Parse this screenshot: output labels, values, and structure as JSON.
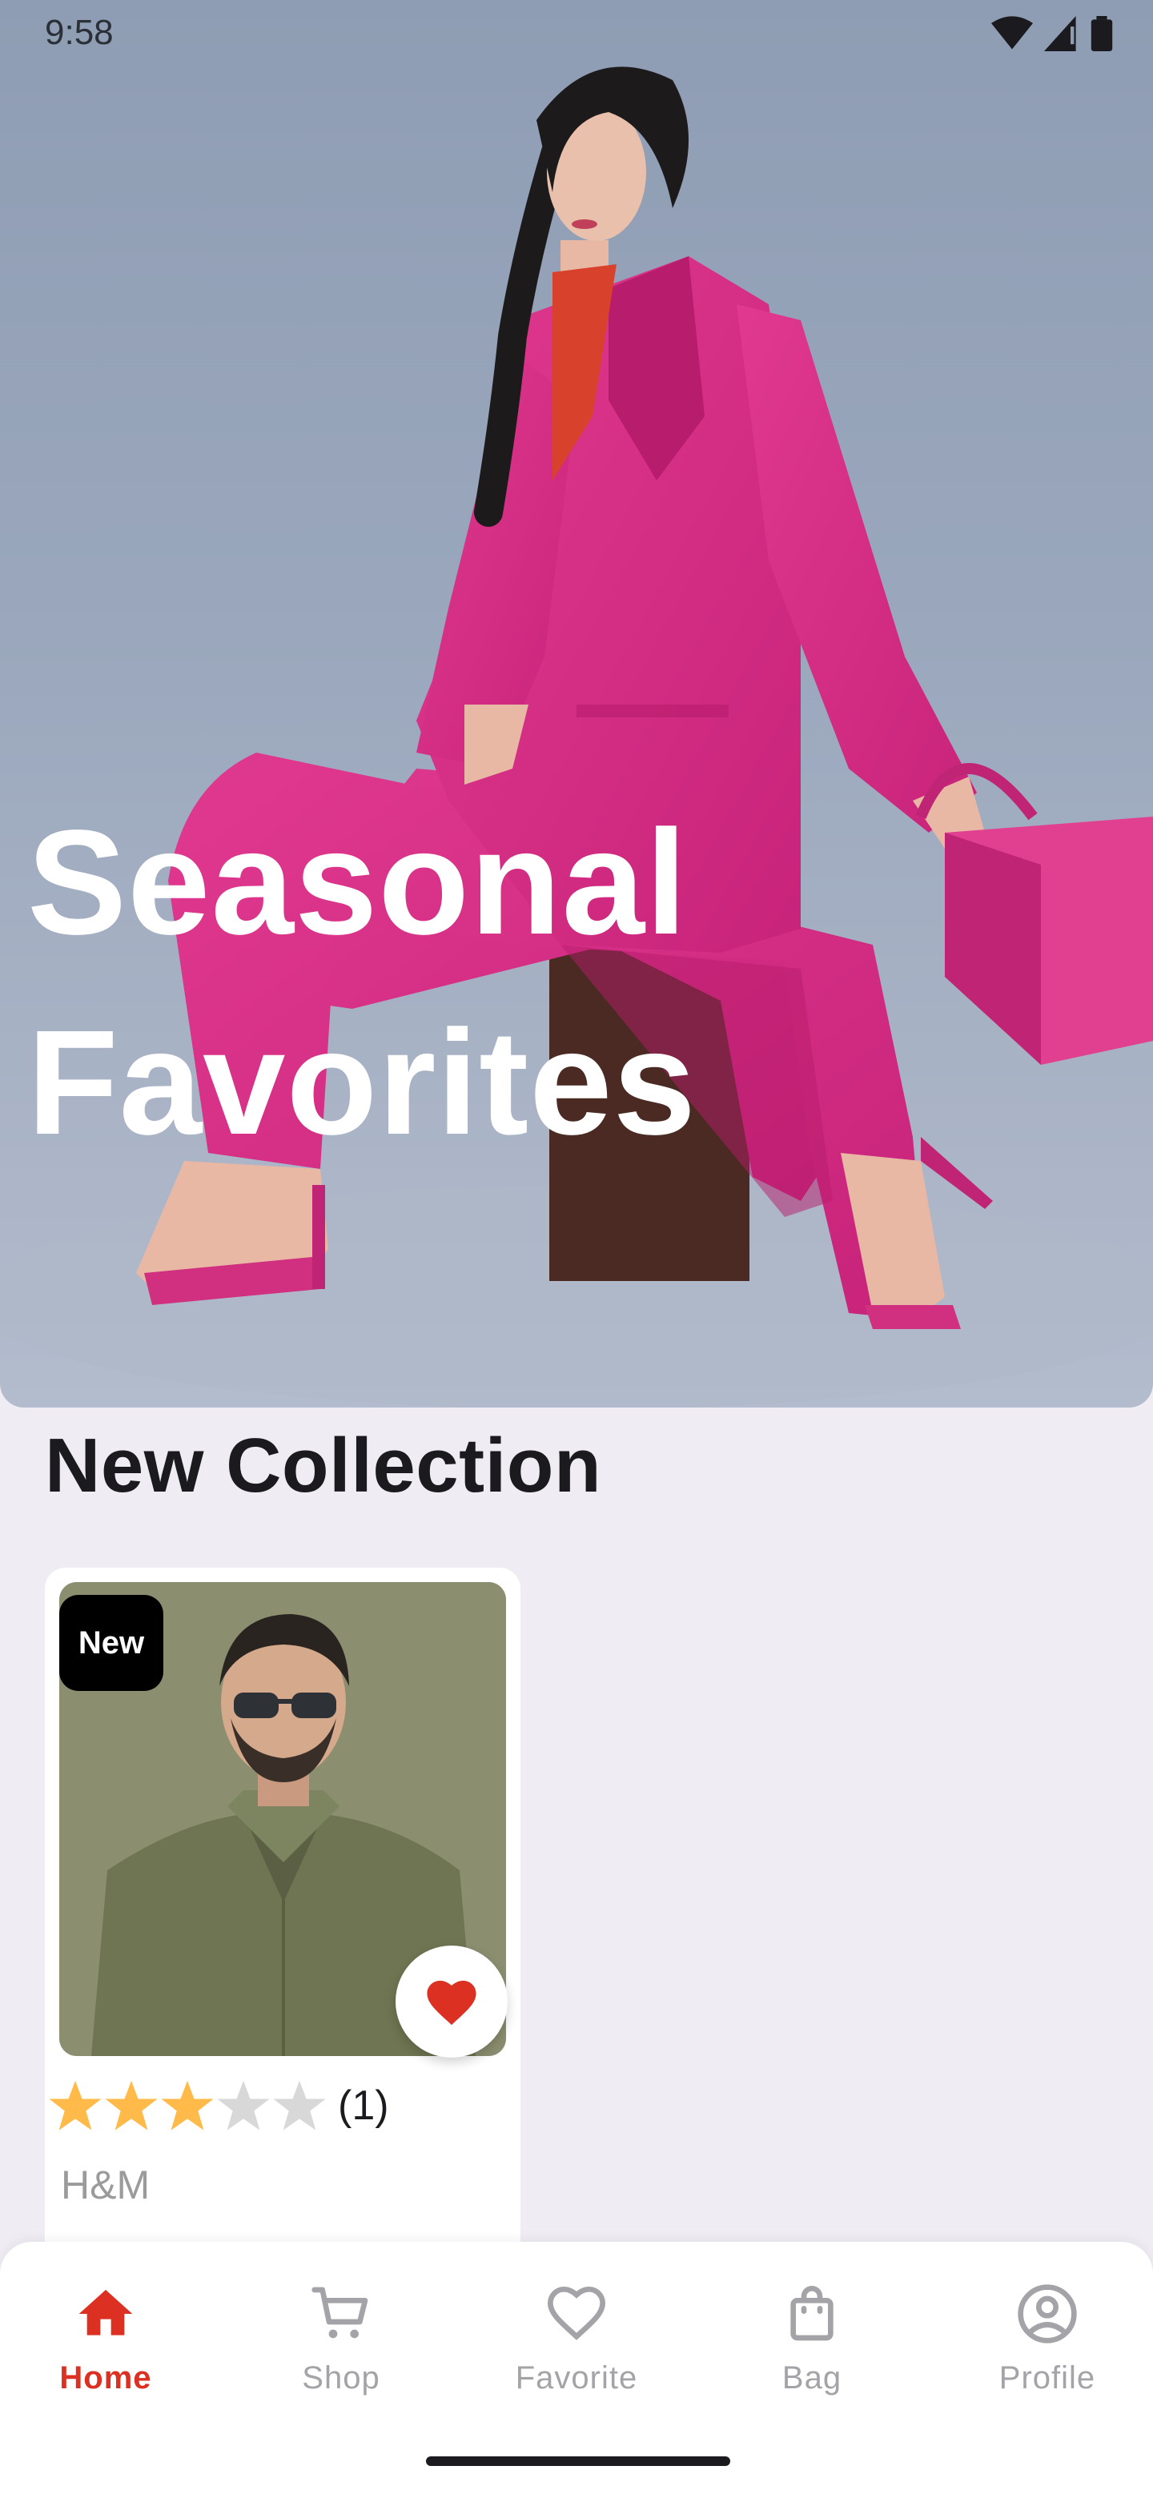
{
  "status_bar": {
    "time": "9:58"
  },
  "hero": {
    "title_line1": "Seasonal",
    "title_line2": "Favorites"
  },
  "section": {
    "title": "New Collection"
  },
  "products": [
    {
      "badge": "New",
      "rating_stars": 3,
      "rating_max": 5,
      "rating_count": "(1)",
      "brand": "H&M",
      "favorited": true
    }
  ],
  "bottom_nav": {
    "items": [
      {
        "label": "Home",
        "icon": "home-icon",
        "active": true
      },
      {
        "label": "Shop",
        "icon": "cart-icon",
        "active": false
      },
      {
        "label": "Favorite",
        "icon": "heart-outline-icon",
        "active": false
      },
      {
        "label": "Bag",
        "icon": "bag-icon",
        "active": false
      },
      {
        "label": "Profile",
        "icon": "profile-icon",
        "active": false
      }
    ]
  },
  "colors": {
    "accent": "#DB3022",
    "hero_suit": "#D62F8A",
    "star": "#FFBA49",
    "inactive": "#A3A3A8"
  }
}
